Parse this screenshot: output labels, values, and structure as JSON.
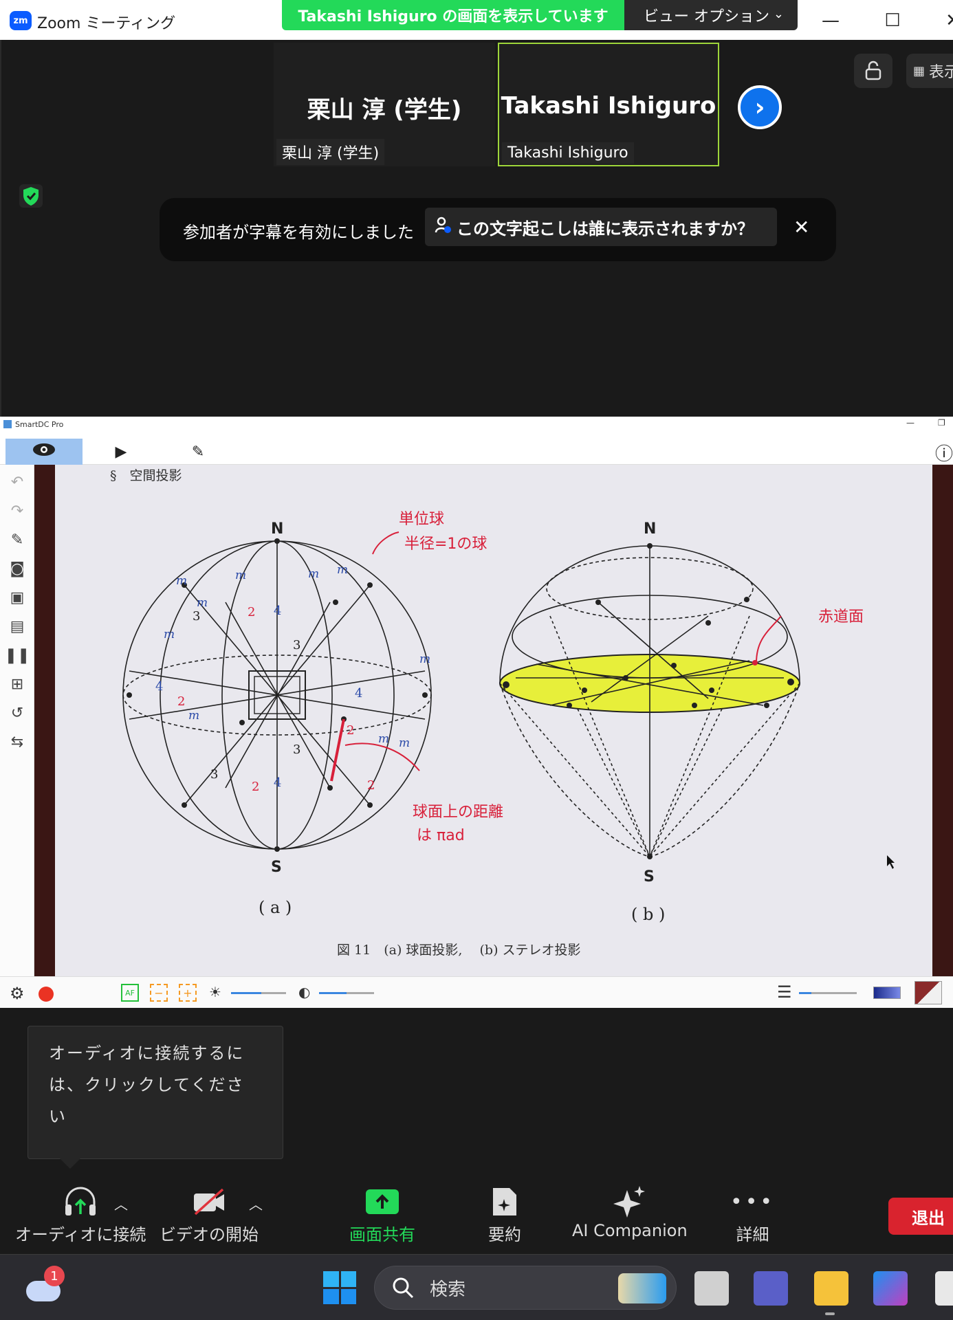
{
  "titlebar": {
    "logo_text": "zm",
    "app_title": "Zoom ミーティング",
    "share_banner": "Takashi  Ishiguro の画面を表示しています",
    "view_options": "ビュー オプション",
    "minimize": "—",
    "maximize": "☐",
    "close": "✕"
  },
  "participants": [
    {
      "name_big": "栗山 淳 (学生)",
      "name_small": "栗山 淳 (学生)"
    },
    {
      "name_big": "Takashi Ishiguro",
      "name_small": "Takashi Ishiguro"
    }
  ],
  "top_right": {
    "view_label": "表示"
  },
  "caption_notice": {
    "text": "参加者が字幕を有効にしました",
    "link": "この文字起こしは誰に表示されますか？",
    "close": "✕"
  },
  "smartdc": {
    "window_title": "SmartDC Pro",
    "info": "ⓘ",
    "page_header": "§　空間投影",
    "fig_a": {
      "n": "N",
      "s": "S",
      "label": "( a )",
      "handwritten_1": "単位球",
      "handwritten_2": "半径=1の球",
      "handwritten_3": "球面上の距離",
      "handwritten_4": "は πad",
      "m": "m",
      "n2": "2",
      "n3": "3",
      "n4": "4"
    },
    "fig_b": {
      "n": "N",
      "s": "S",
      "label": "( b )",
      "handwritten": "赤道面"
    },
    "caption": "図 11　(a) 球面投影,　 (b) ステレオ投影"
  },
  "audio_tooltip": "オーディオに接続するには、クリックしてください",
  "toolbar": {
    "audio": "オーディオに接続",
    "video": "ビデオの開始",
    "share": "画面共有",
    "summary": "要約",
    "ai": "AI Companion",
    "more": "詳細",
    "leave": "退出"
  },
  "taskbar": {
    "search": "検索",
    "badge": "1"
  },
  "colors": {
    "zoom_blue": "#0b5cff",
    "share_green": "#23d959",
    "leave_red": "#d9232e",
    "highlight_yellow": "#e7ef3a",
    "ink_red": "#d8203a"
  }
}
